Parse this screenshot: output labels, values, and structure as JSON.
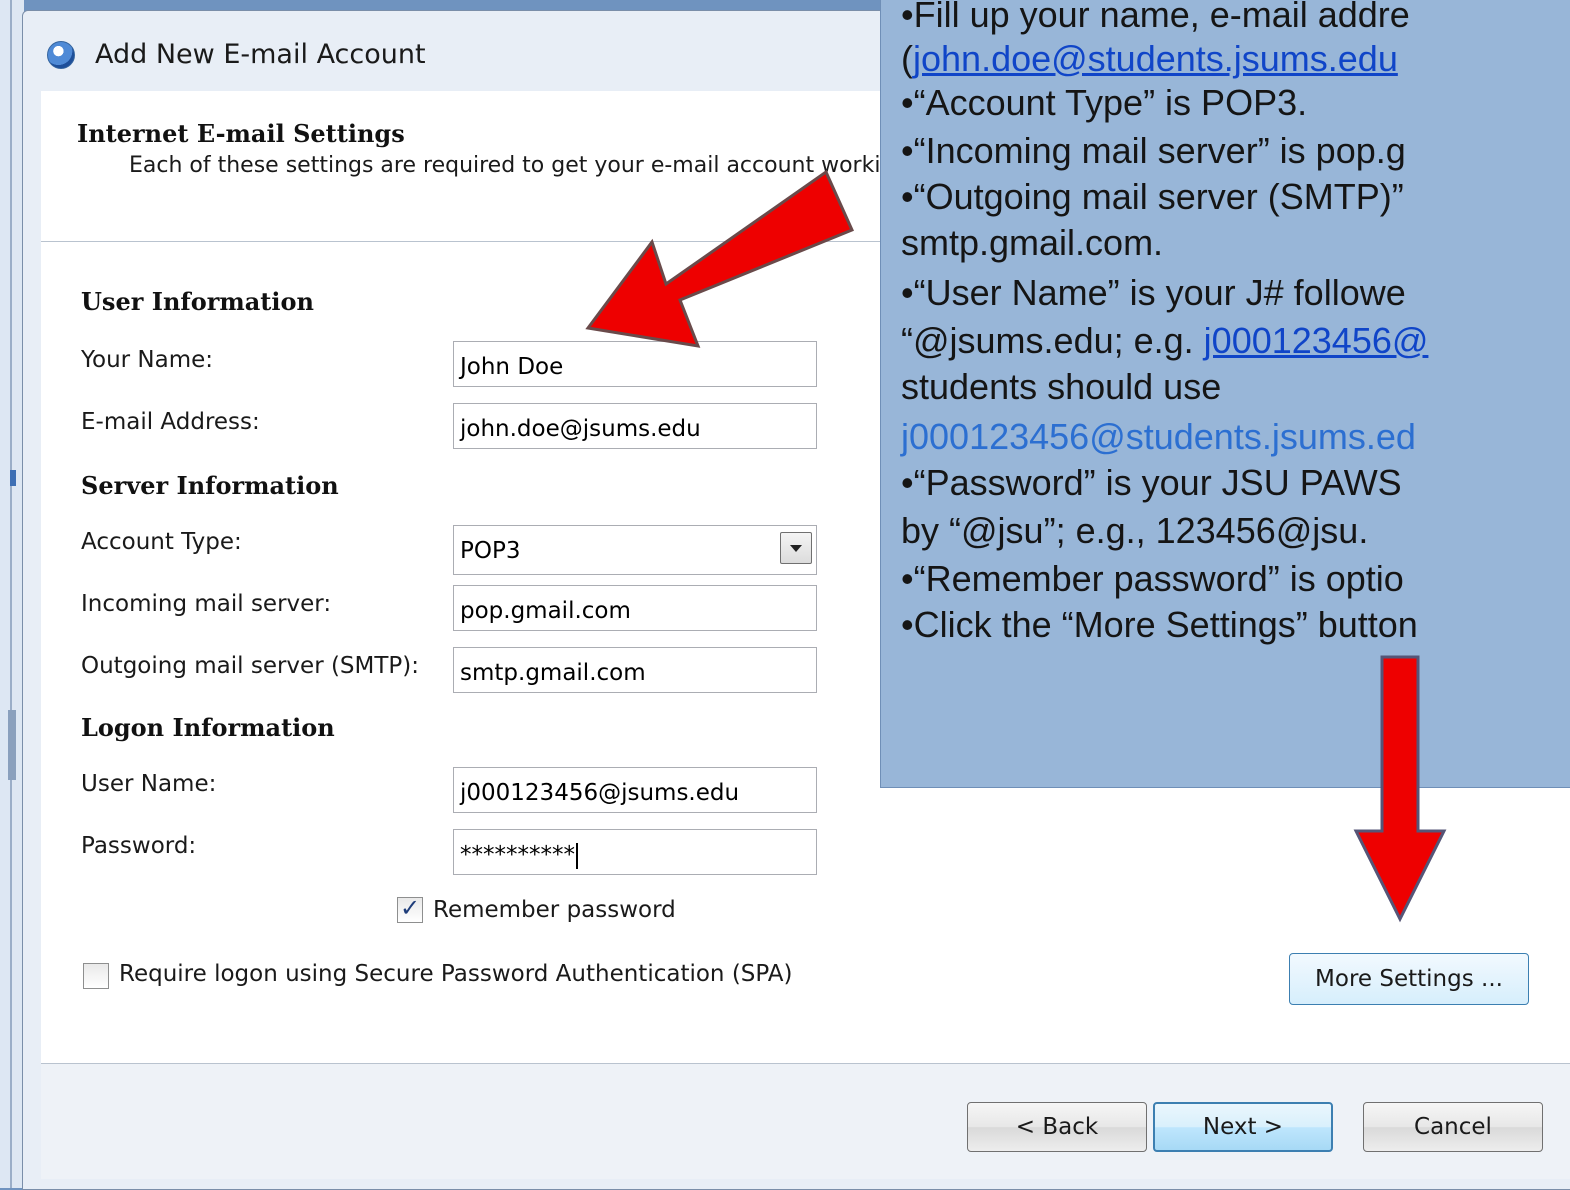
{
  "window": {
    "title": "Add New E-mail Account"
  },
  "header": {
    "title": "Internet E-mail Settings",
    "description": "Each of these settings are required to get your e-mail account working."
  },
  "user_info": {
    "section_title": "User Information",
    "name_label": "Your Name:",
    "name_value": "John Doe",
    "email_label": "E-mail Address:",
    "email_value": "john.doe@jsums.edu"
  },
  "server_info": {
    "section_title": "Server Information",
    "account_type_label": "Account Type:",
    "account_type_value": "POP3",
    "incoming_label": "Incoming mail server:",
    "incoming_value": "pop.gmail.com",
    "outgoing_label": "Outgoing mail server (SMTP):",
    "outgoing_value": "smtp.gmail.com"
  },
  "logon_info": {
    "section_title": "Logon Information",
    "username_label": "User Name:",
    "username_value": "j000123456@jsums.edu",
    "password_label": "Password:",
    "password_value": "**********",
    "remember_label": "Remember password",
    "remember_checked": true,
    "spa_label": "Require logon using Secure Password Authentication (SPA)",
    "spa_checked": false
  },
  "buttons": {
    "more_settings": "More Settings ...",
    "back": "< Back",
    "next": "Next >",
    "cancel": "Cancel"
  },
  "instructions": {
    "l1": "•Fill up your name, e-mail addre",
    "l2_open": "(",
    "l2_link": "john.doe@students.jsums.edu",
    "l3": "•“Account Type” is POP3.",
    "l4": "•“Incoming mail server” is pop.g",
    "l5": "•“Outgoing mail server (SMTP)”",
    "l6": "smtp.gmail.com.",
    "l7": "•“User Name” is your J# followe",
    "l8_text": "“@jsums.edu; e.g. ",
    "l8_link": "j000123456@",
    "l9": "students should use",
    "l10": "j000123456@students.jsums.ed",
    "l11": "•“Password” is your JSU PAWS",
    "l12": "by “@jsu”; e.g., 123456@jsu.",
    "l13": "•“Remember password” is optio",
    "l14": "•Click the “More Settings” button"
  },
  "colors": {
    "arrow": "#ee0000",
    "panel": "#98b6d8",
    "link": "#1045c8"
  }
}
